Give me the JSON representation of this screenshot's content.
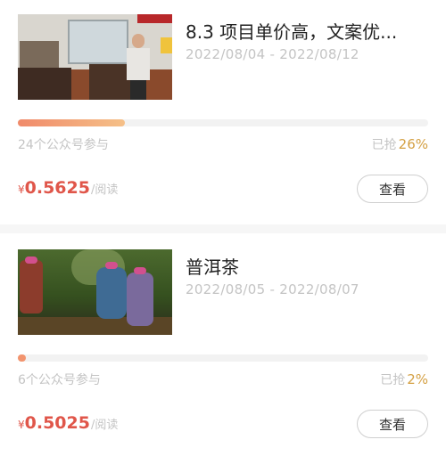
{
  "tasks": [
    {
      "title": "8.3 项目单价高，文案优...",
      "date_range": "2022/08/04 - 2022/08/12",
      "progress": 0.26,
      "participants": "24个公众号参与",
      "grabbed_label": "已抢",
      "grabbed_percent": "26%",
      "currency": "¥",
      "price": "0.5625",
      "price_unit": "/阅读",
      "view_label": "查看"
    },
    {
      "title": "普洱茶",
      "date_range": "2022/08/05 - 2022/08/07",
      "progress": 0.02,
      "participants": "6个公众号参与",
      "grabbed_label": "已抢",
      "grabbed_percent": "2%",
      "currency": "¥",
      "price": "0.5025",
      "price_unit": "/阅读",
      "view_label": "查看"
    }
  ],
  "colors": {
    "price": "#e0564a",
    "percent": "#d4a043",
    "muted": "#c4c4c4",
    "progress_start": "#f08a6a",
    "progress_end": "#f5c088"
  }
}
